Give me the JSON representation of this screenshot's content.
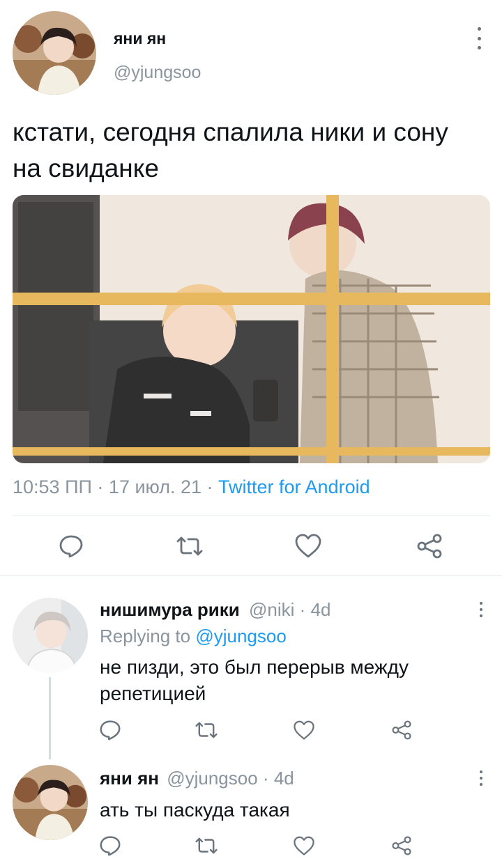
{
  "main_tweet": {
    "display_name": "яни ян",
    "handle": "@yjungsoo",
    "text": "кстати, сегодня спалила ники и сону на свиданке",
    "meta": {
      "time": "10:53 ПП",
      "sep1": "·",
      "date": "17 июл. 21",
      "sep2": "·",
      "source": "Twitter for Android"
    },
    "actions": [
      "reply-icon",
      "retweet-icon",
      "like-icon",
      "share-icon"
    ]
  },
  "replies": [
    {
      "display_name": "нишимура рики",
      "handle": "@niki",
      "sep": "·",
      "age": "4d",
      "replying_prefix": "Replying to",
      "replying_handle": "@yjungsoo",
      "text": "не пизди, это был перерыв между репетицией"
    },
    {
      "display_name": "яни ян",
      "handle": "@yjungsoo",
      "sep": "·",
      "age": "4d",
      "text": "ать ты паскуда такая"
    }
  ],
  "colors": {
    "link": "#1d9bf0",
    "muted": "#8a949e",
    "icon": "#6a737c"
  }
}
